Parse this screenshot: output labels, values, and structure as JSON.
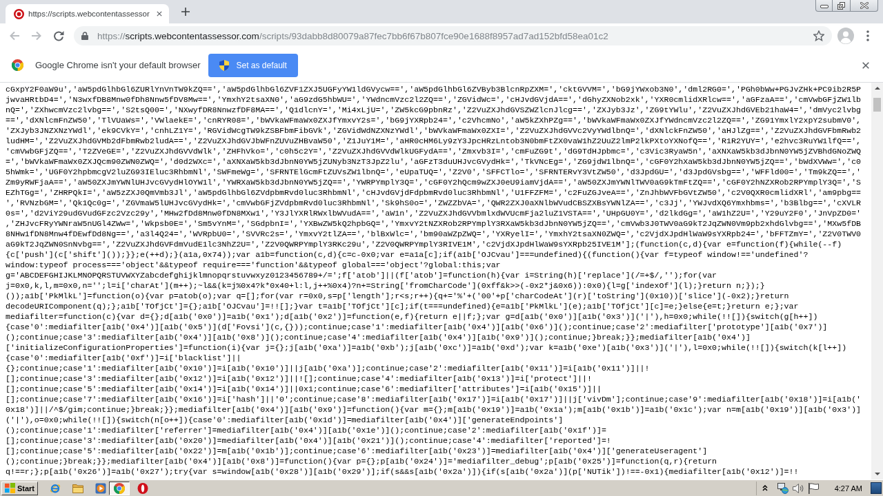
{
  "browser": {
    "tabs": [
      {
        "title": "https://scripts.webcontentassessor",
        "selected": true
      }
    ],
    "back": {
      "disabled": true
    },
    "forward": {
      "disabled": true
    },
    "url": {
      "scheme": "https://",
      "host": "scripts.webcontentassessor.com",
      "path": "/scripts/93dabb8d80079a87fec7bb6f67b807fce90e1688f8957ad7ad152bfd58ea01c2"
    }
  },
  "infobar": {
    "message": "Google Chrome isn't your default browser",
    "button": "Set as default"
  },
  "code_lines": [
    "cGxpY2F0aW9u','aW5pdGlhbGl6ZURlYnVnTW9kZQ==','aW5pdGlhbGl6ZVF1ZXJ5UGFyYW1ldGVycw==','aW5pdGlhbGl6ZVByb3BlcnRpZXM=','cktGVVM=','bG9jYWxob3N0','dml2RG0=','PGh0bWw+PGJvZHk+PC9ib2R5P",
    "jwvaHRtbD4=','N3wxfDB8Mnw0fDh8Nnw5fDV8Mw==','YmxhY2tsaXN0','aG9zdG5hbWU=','YWdncmVzc2l2ZQ==','ZGVidWc=','cHJvdGVjdA==','dGhyZXNob2xk','YXR0cmlidXRlcw==','aGFzaA==','cmVwbGFjZW1lb",
    "nQ=','ZXhwcmVzc2lvbg==','S2tsQ00=','NXwyfDR8NnwzfDF8MA==','Q1dlcnY=','Mi4xLjU=','ZW5kcG9pbnRz','Z2VuZXJhdGVSZWZlcnJlcg==','ZXJyb3Jz','ZG9tYWlu','Z2VuZXJhdGVEb21haW4=','dmVyc2lvbg",
    "==','dXNlcmFnZW50','TlVUaWs=','VWlaekE=','cnRYR08=','bWVkaWFmaWx0ZXJfYmxvY2s=','bG9jYXRpb24=','c2VhcmNo','aW5kZXhPZg==','bWVkaWFmaWx0ZXJfYWdncmVzc2l2ZQ==','ZG91YmxlY2xpY2submV0',",
    "'ZXJyb3JNZXNzYWdl','ek9CVkY=','cnhLZ1Y=','RGVidWcgTW9kZSBFbmFibGVk','ZGVidWdNZXNzYWdl','bWVkaWFmaWx0ZXI=','Z2VuZXJhdGVVc2VyYWdlbnQ=','dXNlckFnZW50','aHJlZg==','Z2VuZXJhdGVFbmRwb2",
    "ludHM=','Z2VuZXJhdGVMb2dFbmRwb2ludA==','Z2VuZXJhdGVJbWFnZUVuZHBvaW50','Z1JuY1M=','aHR0cHM6Ly9zY3JpcHRzLntob3N0bmFtZX0vaW1hZ2UuZ2lmP2lkPXtoYXNofQ==','R1R2YUY=','e2hvc3RuYW1lfQ==',",
    "'cmVwbGFjZQ==','T2ZVeGE=','Z2VuZXJhdGVVdWlk','ZHFhVko=','c0h5c2Y=','Z2VuZXJhdGVVdWlkUGFydA==','Zmxvb3I=','cmFuZG9t','dG9TdHJpbmc=','c3Vic3RyaW5n','aXNXaW5kb3dJbnN0YW5jZVBhdGNoZWQ",
    "=','bWVkaWFmaWx0ZXJQcm90ZWN0ZWQ=','d0d2WXc=','aXNXaW5kb3dJbnN0YW5jZUNyb3NzT3JpZ2lu','aGFzT3duUHJvcGVydHk=','TkVNcEg=','ZG9jdW1lbnQ=','cGF0Y2hXaW5kb3dJbnN0YW5jZQ==','bWdXVWw=','c0",
    "5hWmk=','UGF0Y2hpbmcgV2luZG93IEluc3RhbmNl','SWFmeWg=','SFRNTElGcmFtZUVsZW1lbnQ=','eUpaTUQ=','Z2V0','SFFCTlo=','SFRNTERvY3VtZW50','d3JpdGU=','d3JpdGVsbg==','WFFld00=','Tm9kZQ==','",
    "Zm9yRWFjaA==','aW50ZXJmYWNlUHJvcGVydHlOYW1l','YWRXaW5kb3dJbnN0YW5jZQ==','YWRPYmplY3Q=','cGF0Y2hQcm9wZXJ0eU9iamVjdA==','aW50ZXJmYWNlTWV0aG9kTmFtZQ==','cGF0Y2hNZXRob2RPYmplY3Q=','S",
    "EZhTGg=','ZHRPQkI=','aW5zZXJ0QmVmb3Jl','aW5pdGlhbGl6ZVdpbmRvd0luc3RhbmNl','cHJvdGVjdFdpbmRvd0luc3RhbmNl','U1FFZFM=','c2FuZGJveA==','ZnJhbWVFbGVtZW50','c2V0QXR0cmlidXRl','am9pbg==",
    "','RVNzbGM=','Qk1Qc0g=','ZGVmaW5lUHJvcGVydHk=','cmVwbGFjZVdpbmRvd0luc3RhbmNl','Sk9hS0o=','ZWZZbVA=','QWR2ZXJ0aXNlbWVudCBSZXBsYWNlZA==','c3Jj','YWJvdXQ6Ymxhbms=','b3Blbg==','cXVLR",
    "0s=','d2ViY29udGVudGFzc2Vzc29y','MHw2fDd8Mnw0fDN8MXw1','Y3JlYXRlRWxlbWVudA==','aW1n','Z2VuZXJhdGVVbmlxdWVUcmFja2luZ1VSTA==','UHpGU0Y=','d2lkdGg=','aW1hZ2U=','Y29uY2F0','JnVpZD0='",
    ",'ZHJvcFRyYWNraW5nUGl4ZWw=','Wkpsb0E=','Sm5vYnM=','SGdpbnI=','YXBwZW5kQ2hpbGQ=','YmxvY2tNZXRob2RPYmplY3RXaW5kb3dJbnN0YW5jZQ==','cmVwb3J0TWV0aG9kT2JqZWN0Vm9pb2xhdGlvbg==','MXw5fDB",
    "8NHw1fDN8Mnw4fDEwfDd8Ng==','a3l4Q24=','WVRpbU0=','SVVRc2s=','YmxvY2tlZA==','blBxWlc=','bm90aWZpZWQ=','YXRyelI=','YmxhY2tsaXN0ZWQ=','c2VjdXJpdHlWaW9sYXRpb24=','bFFTZmY=','Z2V0TWV0",
    "aG9kT2JqZWN0SnNvbg==','Z2VuZXJhdGVFdmVudE1lc3NhZ2U=','Z2V0QWRPYmplY3RKc29u','Z2V0QWRPYmplY3RIVE1M','c2VjdXJpdHlWaW9sYXRpb25IVE1M'];(function(c,d){var e=function(f){while(--f)",
    "{c['push'](c['shift']());}};e(++d);}(a1a,0x74));var a1b=function(c,d){c=c-0x0;var e=a1a[c];if(a1b['OJCvau']===undefined){(function(){var f=typeof window!=='undefined'?",
    "window:typeof process==='object'&&typeof require==='function'&&typeof global==='object'?global:this;var",
    "g='ABCDEFGHIJKLMNOPQRSTUVWXYZabcdefghijklmnopqrstuvwxyz0123456789+/=';f['atob']||(f['atob']=function(h){var i=String(h)['replace'](/=+$/,'');for(var",
    "j=0x0,k,l,m=0x0,n='';l=i['charAt'](m++);~l&&(k=j%0x4?k*0x40+l:l,j++%0x4)?n+=String['fromCharCode'](0xff&k>>(-0x2*j&0x6)):0x0){l=g['indexOf'](l);}return n;});}",
    "());a1b['PkMlkL']=function(o){var p=atob(o);var q=[];for(var r=0x0,s=p['length'];r<s;r++){q+='%'+('00'+p['charCodeAt'](r)['toString'](0x10))['slice'](-0x2);}return",
    "decodeURIComponent(q);};a1b['TOfjCt']={};a1b['OJCvau']=!![];}var t=a1b['TOfjCt'][c];if(t===undefined){e=a1b['PkMlkL'](e);a1b['TOfjCt'][c]=e;}else{e=t;}return e;};var",
    "mediafilter=function(c){var d={};d[a1b('0x0')]=a1b('0x1');d[a1b('0x2')]=function(e,f){return e||f;};var g=d[a1b('0x0')][a1b('0x3')]('|'),h=0x0;while(!![]){switch(g[h++])",
    "{case'0':mediafilter[a1b('0x4')][a1b('0x5')](d['Fovsi'](c,{}));continue;case'1':mediafilter[a1b('0x4')][a1b('0x6')]();continue;case'2':mediafilter['prototype'][a1b('0x7')]",
    "();continue;case'3':mediafilter[a1b('0x4')][a1b('0x8')]();continue;case'4':mediafilter[a1b('0x4')][a1b('0x9')]();continue;}break;}};mediafilter[a1b('0x4')]",
    "['initializeConfigurationProperties']=function(i){var j={};j[a1b('0xa')]=a1b('0xb');j[a1b('0xc')]=a1b('0xd');var k=a1b('0xe')[a1b('0x3')]('|'),l=0x0;while(!![]){switch(k[l++])",
    "{case'0':mediafilter[a1b('0xf')]=i['blacklist']||",
    "{};continue;case'1':mediafilter[a1b('0x10')]=i[a1b('0x10')]||j[a1b('0xa')];continue;case'2':mediafilter[a1b('0x11')]=i[a1b('0x11')]||!",
    "[];continue;case'3':mediafilter[a1b('0x12')]=i[a1b('0x12')]||![];continue;case'4':mediafilter[a1b('0x13')]=i['protect']||!",
    "[];continue;case'5':mediafilter[a1b('0x14')]=i[a1b('0x14')]||0x1;continue;case'6':mediafilter['attributes']=i[a1b('0x15')]||",
    "[];continue;case'7':mediafilter[a1b('0x16')]=i['hash']||'0';continue;case'8':mediafilter[a1b('0x17')]=i[a1b('0x17')]||j['vivDm'];continue;case'9':mediafilter[a1b('0x18')]=i[a1b('",
    "0x18')]||/^$/gim;continue;}break;}};mediafilter[a1b('0x4')][a1b('0x9')]=function(){var m={};m[a1b('0x19')]=a1b('0x1a');m[a1b('0x1b')]=a1b('0x1c');var n=m[a1b('0x19')][a1b('0x3')]",
    "('|'),o=0x0;while(!![]){switch(n[o++]){case'0':mediafilter[a1b('0x1d')]=mediafilter[a1b('0x4')]['generateEndpoints']",
    "();continue;case'1':mediafilter['referrer']=mediafilter[a1b('0x4')][a1b('0x1e')]();continue;case'2':mediafilter[a1b('0x1f')]=",
    "[];continue;case'3':mediafilter[a1b('0x20')]=mediafilter[a1b('0x4')][a1b('0x21')]();continue;case'4':mediafilter['reported']=!",
    "[];continue;case'5':mediafilter[a1b('0x22')]=m[a1b('0x1b')];continue;case'6':mediafilter[a1b('0x23')]=mediafilter[a1b('0x4')]['generateUseragent']",
    "();continue;}break;}};mediafilter[a1b('0x4')][a1b('0x8')]=function(){var p={};p[a1b('0x24')]='mediafilter_debug';p[a1b('0x25')]=function(q,r){return",
    "q!==r;};p[a1b('0x26')]=a1b('0x27');try{var s=window[a1b('0x28')][a1b('0x29')];if(s&&s[a1b('0x2a')]){if(s[a1b('0x2a')](p['NUTik'])!==-0x1){mediafilter[a1b('0x12')]=!!"
  ],
  "taskbar": {
    "start": "Start",
    "tasks": [
      {
        "selected": true
      },
      {
        "selected": false
      }
    ],
    "clock": "4:27 AM"
  }
}
